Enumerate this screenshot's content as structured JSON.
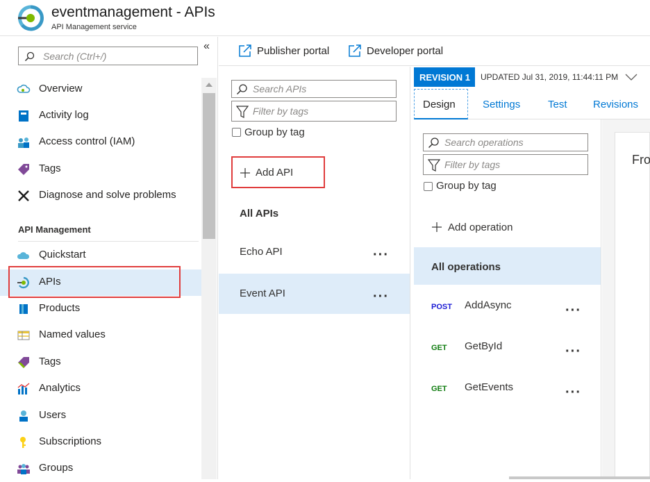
{
  "header": {
    "title": "eventmanagement - APIs",
    "subtitle": "API Management service"
  },
  "nav": {
    "search_placeholder": "Search (Ctrl+/)",
    "collapse_glyph": "«",
    "items": [
      {
        "label": "Overview",
        "icon": "overview-icon"
      },
      {
        "label": "Activity log",
        "icon": "activity-log-icon"
      },
      {
        "label": "Access control (IAM)",
        "icon": "iam-icon"
      },
      {
        "label": "Tags",
        "icon": "tag-icon"
      },
      {
        "label": "Diagnose and solve problems",
        "icon": "wrench-icon"
      }
    ],
    "section_label": "API Management",
    "section_items": [
      {
        "label": "Quickstart",
        "icon": "cloud-icon"
      },
      {
        "label": "APIs",
        "icon": "apis-icon",
        "active": true
      },
      {
        "label": "Products",
        "icon": "products-icon"
      },
      {
        "label": "Named values",
        "icon": "table-icon"
      },
      {
        "label": "Tags",
        "icon": "tag-icon"
      },
      {
        "label": "Analytics",
        "icon": "analytics-icon"
      },
      {
        "label": "Users",
        "icon": "user-icon"
      },
      {
        "label": "Subscriptions",
        "icon": "key-icon"
      },
      {
        "label": "Groups",
        "icon": "groups-icon"
      }
    ]
  },
  "toolbar": {
    "publisher_portal": "Publisher portal",
    "developer_portal": "Developer portal"
  },
  "apis": {
    "search_placeholder": "Search APIs",
    "filter_placeholder": "Filter by tags",
    "group_by_tag": "Group by tag",
    "add_api": "Add API",
    "all_apis": "All APIs",
    "items": [
      {
        "label": "Echo API"
      },
      {
        "label": "Event API",
        "active": true
      }
    ],
    "more_glyph": "···"
  },
  "revision": {
    "badge": "REVISION 1",
    "updated": "UPDATED Jul 31, 2019, 11:44:11 PM"
  },
  "tabs": [
    {
      "label": "Design",
      "active": true
    },
    {
      "label": "Settings"
    },
    {
      "label": "Test"
    },
    {
      "label": "Revisions"
    }
  ],
  "operations": {
    "search_placeholder": "Search operations",
    "filter_placeholder": "Filter by tags",
    "group_by_tag": "Group by tag",
    "add_operation": "Add operation",
    "all_operations": "All operations",
    "items": [
      {
        "method": "POST",
        "name": "AddAsync"
      },
      {
        "method": "GET",
        "name": "GetById"
      },
      {
        "method": "GET",
        "name": "GetEvents"
      }
    ]
  },
  "right_pane": {
    "label": "Fro"
  },
  "colors": {
    "accent": "#0078d4",
    "active_bg": "#deecf9",
    "highlight": "#e03c3c",
    "post_color": "#1a1ad4",
    "get_color": "#107c10"
  }
}
